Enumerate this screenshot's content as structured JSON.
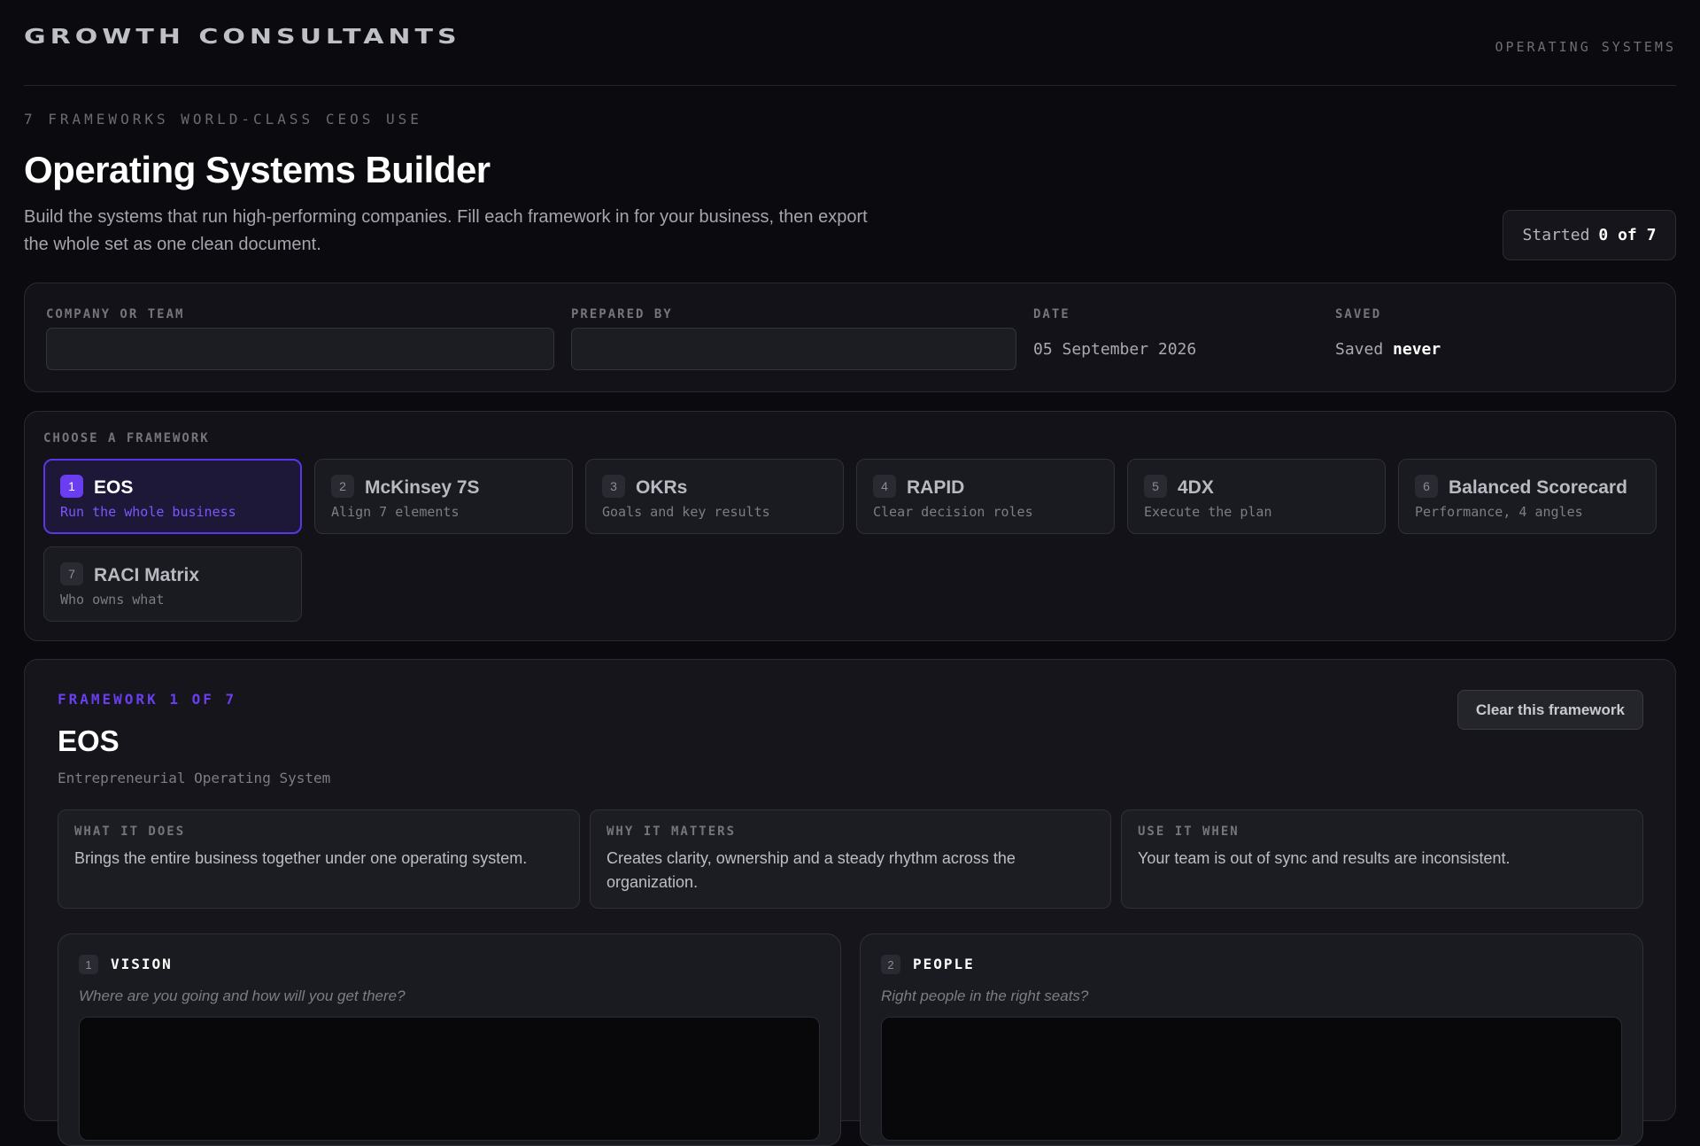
{
  "header": {
    "brand": "GROWTH CONSULTANTS",
    "nav_label": "OPERATING SYSTEMS"
  },
  "hero": {
    "eyebrow": "7 FRAMEWORKS WORLD-CLASS CEOS USE",
    "title": "Operating Systems Builder",
    "intro": "Build the systems that run high-performing companies. Fill each framework in for your business, then export the whole set as one clean document.",
    "progress_prefix": "Started",
    "progress_value": "0 of 7"
  },
  "meta": {
    "company_label": "COMPANY OR TEAM",
    "company_value": "",
    "prepared_label": "PREPARED BY",
    "prepared_value": "",
    "date_label": "DATE",
    "date_value": "05 September 2026",
    "saved_label": "SAVED",
    "saved_prefix": "Saved",
    "saved_value": "never"
  },
  "chooser": {
    "label": "CHOOSE A FRAMEWORK",
    "frameworks": [
      {
        "num": "1",
        "name": "EOS",
        "desc": "Run the whole business",
        "active": true
      },
      {
        "num": "2",
        "name": "McKinsey 7S",
        "desc": "Align 7 elements",
        "active": false
      },
      {
        "num": "3",
        "name": "OKRs",
        "desc": "Goals and key results",
        "active": false
      },
      {
        "num": "4",
        "name": "RAPID",
        "desc": "Clear decision roles",
        "active": false
      },
      {
        "num": "5",
        "name": "4DX",
        "desc": "Execute the plan",
        "active": false
      },
      {
        "num": "6",
        "name": "Balanced Scorecard",
        "desc": "Performance, 4 angles",
        "active": false
      },
      {
        "num": "7",
        "name": "RACI Matrix",
        "desc": "Who owns what",
        "active": false
      }
    ]
  },
  "detail": {
    "kicker": "FRAMEWORK 1 OF 7",
    "title": "EOS",
    "subtitle": "Entrepreneurial Operating System",
    "clear_label": "Clear this framework",
    "info": [
      {
        "label": "WHAT IT DOES",
        "text": "Brings the entire business together under one operating system."
      },
      {
        "label": "WHY IT MATTERS",
        "text": "Creates clarity, ownership and a steady rhythm across the organization."
      },
      {
        "label": "USE IT WHEN",
        "text": "Your team is out of sync and results are inconsistent."
      }
    ],
    "blocks": [
      {
        "num": "1",
        "title": "VISION",
        "prompt": "Where are you going and how will you get there?",
        "value": ""
      },
      {
        "num": "2",
        "title": "PEOPLE",
        "prompt": "Right people in the right seats?",
        "value": ""
      }
    ]
  },
  "colors": {
    "accent": "#6a3ef0",
    "accent_text": "#7b57ff",
    "background": "#0b0b0f",
    "panel": "#121218"
  }
}
